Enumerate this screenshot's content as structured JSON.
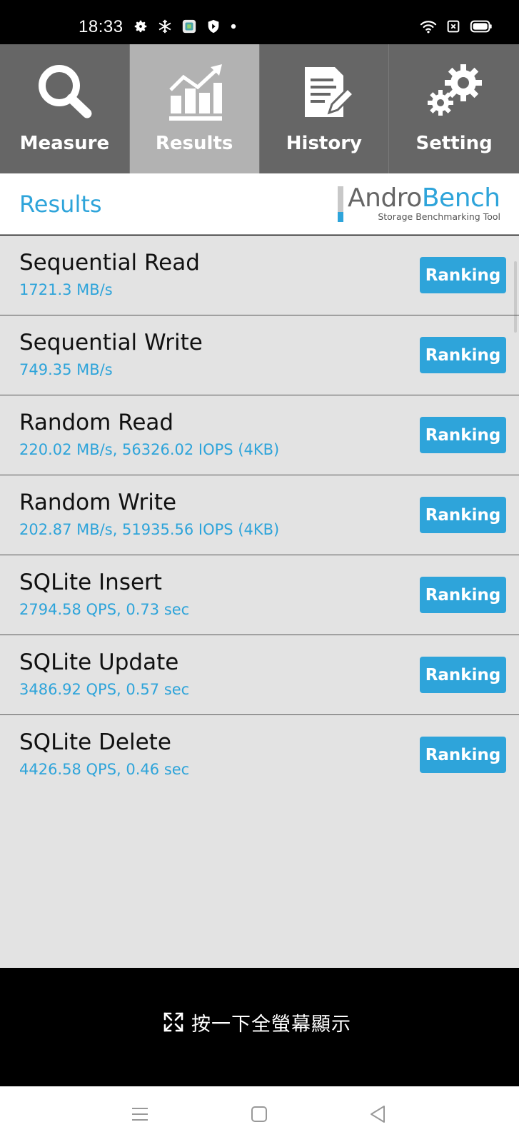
{
  "status_bar": {
    "time": "18:33",
    "left_icons": [
      "gear-icon",
      "snowflake-icon",
      "app-notification-icon",
      "shield-icon",
      "dot-icon"
    ],
    "right_icons": [
      "wifi-icon",
      "sim-icon",
      "battery-icon"
    ]
  },
  "tabs": [
    {
      "label": "Measure",
      "icon": "magnifier-icon",
      "active": false
    },
    {
      "label": "Results",
      "icon": "chart-icon",
      "active": true
    },
    {
      "label": "History",
      "icon": "document-edit-icon",
      "active": false
    },
    {
      "label": "Setting",
      "icon": "gears-icon",
      "active": false
    }
  ],
  "header": {
    "title": "Results",
    "logo_part1": "Andro",
    "logo_part2": "Bench",
    "logo_subtitle": "Storage Benchmarking Tool"
  },
  "results": [
    {
      "name": "Sequential Read",
      "value": "1721.3 MB/s",
      "button": "Ranking"
    },
    {
      "name": "Sequential Write",
      "value": "749.35 MB/s",
      "button": "Ranking"
    },
    {
      "name": "Random Read",
      "value": "220.02 MB/s, 56326.02 IOPS (4KB)",
      "button": "Ranking"
    },
    {
      "name": "Random Write",
      "value": "202.87 MB/s, 51935.56 IOPS (4KB)",
      "button": "Ranking"
    },
    {
      "name": "SQLite Insert",
      "value": "2794.58 QPS, 0.73 sec",
      "button": "Ranking"
    },
    {
      "name": "SQLite Update",
      "value": "3486.92 QPS, 0.57 sec",
      "button": "Ranking"
    },
    {
      "name": "SQLite Delete",
      "value": "4426.58 QPS, 0.46 sec",
      "button": "Ranking"
    }
  ],
  "fullscreen": {
    "label": "按一下全螢幕顯示",
    "icon": "expand-icon"
  },
  "nav_bar": {
    "buttons": [
      "menu-icon",
      "home-icon",
      "back-icon"
    ]
  },
  "colors": {
    "accent": "#2ea4da",
    "tab_bg": "#666666",
    "tab_active": "#b2b2b2",
    "list_bg": "#e3e3e3"
  }
}
